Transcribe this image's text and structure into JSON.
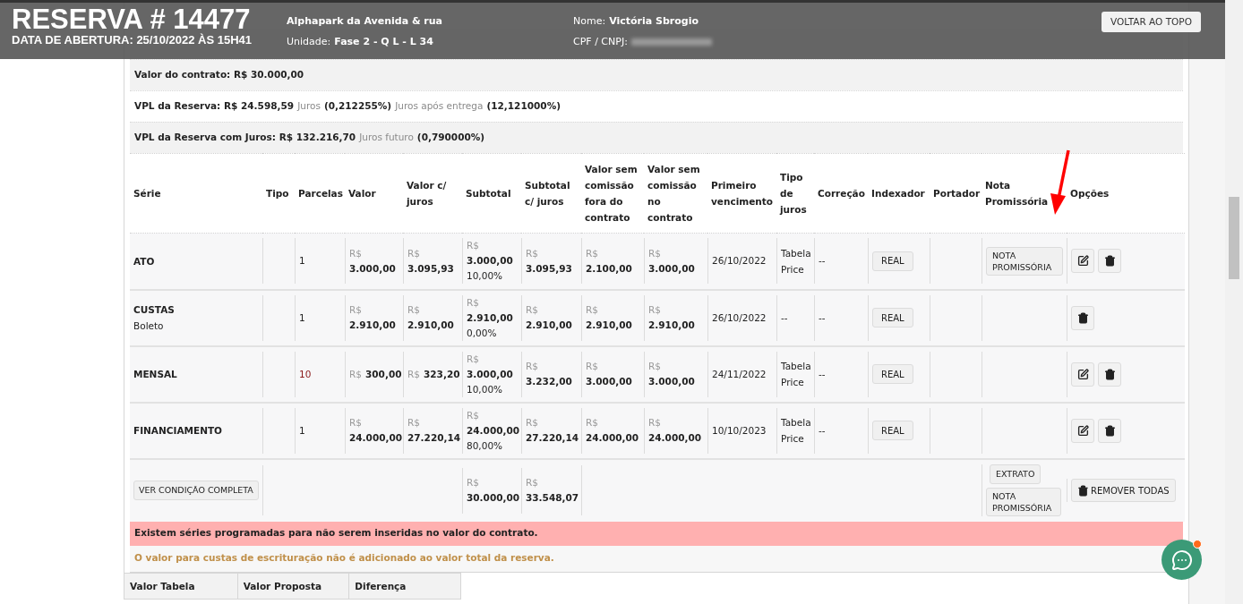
{
  "header": {
    "title": "RESERVA # 14477",
    "opened": "DATA DE ABERTURA: 25/10/2022 ÀS 15H41",
    "project": "Alphapark da Avenida & rua",
    "unit_label": "Unidade:",
    "unit_value": "Fase 2 - Q L - L 34",
    "name_label": "Nome:",
    "name_value": "Victória Sbrogio",
    "cpf_label": "CPF / CNPJ:",
    "back_button": "VOLTAR AO TOPO"
  },
  "summary": [
    [
      {
        "kind": "value",
        "text": "Valor do contrato: R$ 30.000,00"
      }
    ],
    [
      {
        "kind": "value",
        "text": "VPL da Reserva: R$ 24.598,59"
      },
      {
        "kind": "label",
        "text": "Juros"
      },
      {
        "kind": "value",
        "text": "(0,212255%)"
      },
      {
        "kind": "label",
        "text": "Juros após entrega"
      },
      {
        "kind": "value",
        "text": "(12,121000%)"
      }
    ],
    [
      {
        "kind": "value",
        "text": "VPL da Reserva com Juros: R$ 132.216,70"
      },
      {
        "kind": "label",
        "text": "Juros futuro"
      },
      {
        "kind": "value",
        "text": "(0,790000%)"
      }
    ]
  ],
  "columns": [
    "Série",
    "Tipo",
    "Parcelas",
    "Valor",
    "Valor c/ juros",
    "Subtotal",
    "Subtotal c/ juros",
    "Valor sem comissão fora do contrato",
    "Valor sem comissão no contrato",
    "Primeiro vencimento",
    "Tipo de juros",
    "Correção",
    "Indexador",
    "Portador",
    "Nota Promissória",
    "Opções"
  ],
  "rows": [
    {
      "serie": "ATO",
      "parcelas": "1",
      "inline": false,
      "valor": {
        "currency": "R$",
        "amount": "3.000,00"
      },
      "valor_juros": {
        "currency": "R$",
        "amount": "3.095,93"
      },
      "subtotal": {
        "currency": "R$",
        "amount": "3.000,00"
      },
      "percent": "10,00%",
      "subtotal_juros": {
        "currency": "R$",
        "amount": "3.095,93"
      },
      "fora": {
        "currency": "R$",
        "amount": "2.100,00"
      },
      "no": {
        "currency": "R$",
        "amount": "3.000,00"
      },
      "vencimento": "26/10/2022",
      "tipo_juros": "Tabela Price",
      "correcao": "--",
      "indexador": "REAL",
      "nota": "NOTA PROMISSÓRIA",
      "editable": true
    },
    {
      "serie": "CUSTAS",
      "sub": "Boleto",
      "parcelas": "1",
      "inline": false,
      "valor": {
        "currency": "R$",
        "amount": "2.910,00"
      },
      "valor_juros": {
        "currency": "R$",
        "amount": "2.910,00"
      },
      "subtotal": {
        "currency": "R$",
        "amount": "2.910,00"
      },
      "percent": "0,00%",
      "subtotal_juros": {
        "currency": "R$",
        "amount": "2.910,00"
      },
      "fora": {
        "currency": "R$",
        "amount": "2.910,00"
      },
      "no": {
        "currency": "R$",
        "amount": "2.910,00"
      },
      "vencimento": "26/10/2022",
      "tipo_juros": "--",
      "correcao": "--",
      "indexador": "REAL",
      "editable": false
    },
    {
      "serie": "MENSAL",
      "parcelas": "10",
      "inline": true,
      "valor": {
        "currency": "R$",
        "amount": "300,00"
      },
      "valor_juros": {
        "currency": "R$",
        "amount": "323,20"
      },
      "subtotal": {
        "currency": "R$",
        "amount": "3.000,00"
      },
      "percent": "10,00%",
      "subtotal_juros": {
        "currency": "R$",
        "amount": "3.232,00"
      },
      "fora": {
        "currency": "R$",
        "amount": "3.000,00"
      },
      "no": {
        "currency": "R$",
        "amount": "3.000,00"
      },
      "vencimento": "24/11/2022",
      "tipo_juros": "Tabela Price",
      "correcao": "--",
      "indexador": "REAL",
      "editable": true
    },
    {
      "serie": "FINANCIAMENTO",
      "parcelas": "1",
      "inline": false,
      "valor": {
        "currency": "R$",
        "amount": "24.000,00"
      },
      "valor_juros": {
        "currency": "R$",
        "amount": "27.220,14"
      },
      "subtotal": {
        "currency": "R$",
        "amount": "24.000,00"
      },
      "percent": "80,00%",
      "subtotal_juros": {
        "currency": "R$",
        "amount": "27.220,14"
      },
      "fora": {
        "currency": "R$",
        "amount": "24.000,00"
      },
      "no": {
        "currency": "R$",
        "amount": "24.000,00"
      },
      "vencimento": "10/10/2023",
      "tipo_juros": "Tabela Price",
      "correcao": "--",
      "indexador": "REAL",
      "editable": true
    }
  ],
  "footer": {
    "full_button": "VER CONDIÇÃO COMPLETA",
    "subtotal": {
      "currency": "R$",
      "amount": "30.000,00"
    },
    "subtotal_juros": {
      "currency": "R$",
      "amount": "33.548,07"
    },
    "extrato": "EXTRATO",
    "nota": "NOTA PROMISSÓRIA",
    "remove": "REMOVER TODAS"
  },
  "alert": "Existem séries programadas para não serem inseridas no valor do contrato.",
  "note": "O valor para custas de escrituração não é adicionado ao valor total da reserva.",
  "bottom_table": [
    "Valor Tabela",
    "Valor Proposta",
    "Diferença"
  ]
}
